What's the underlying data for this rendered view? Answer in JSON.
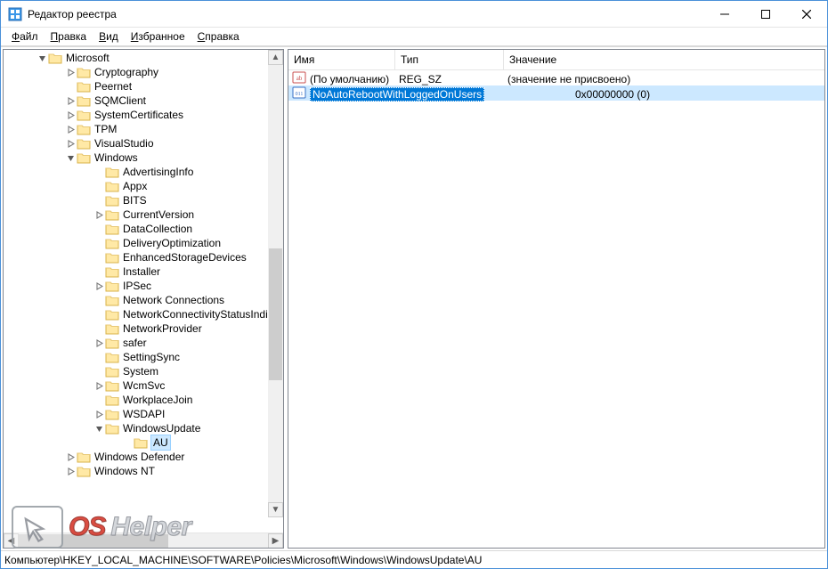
{
  "window": {
    "title": "Редактор реестра"
  },
  "menus": [
    {
      "accel": "Ф",
      "rest": "айл"
    },
    {
      "accel": "П",
      "rest": "равка"
    },
    {
      "accel": "В",
      "rest": "ид"
    },
    {
      "accel": "И",
      "rest": "збранное"
    },
    {
      "accel": "С",
      "rest": "правка"
    }
  ],
  "tree": {
    "root": {
      "name": "Microsoft",
      "children": [
        {
          "name": "Cryptography",
          "expandable": true
        },
        {
          "name": "Peernet"
        },
        {
          "name": "SQMClient",
          "expandable": true
        },
        {
          "name": "SystemCertificates",
          "expandable": true
        },
        {
          "name": "TPM",
          "expandable": true
        },
        {
          "name": "VisualStudio",
          "expandable": true
        },
        {
          "name": "Windows",
          "expanded": true,
          "children": [
            {
              "name": "AdvertisingInfo"
            },
            {
              "name": "Appx"
            },
            {
              "name": "BITS"
            },
            {
              "name": "CurrentVersion",
              "expandable": true
            },
            {
              "name": "DataCollection"
            },
            {
              "name": "DeliveryOptimization"
            },
            {
              "name": "EnhancedStorageDevices"
            },
            {
              "name": "Installer"
            },
            {
              "name": "IPSec",
              "expandable": true
            },
            {
              "name": "Network Connections"
            },
            {
              "name": "NetworkConnectivityStatusIndicator",
              "clip": "NetworkConnectivityStatusIndic"
            },
            {
              "name": "NetworkProvider"
            },
            {
              "name": "safer",
              "expandable": true
            },
            {
              "name": "SettingSync"
            },
            {
              "name": "System"
            },
            {
              "name": "WcmSvc",
              "expandable": true
            },
            {
              "name": "WorkplaceJoin"
            },
            {
              "name": "WSDAPI",
              "expandable": true
            },
            {
              "name": "WindowsUpdate",
              "expanded": true,
              "children": [
                {
                  "name": "AU",
                  "selected": true
                }
              ]
            }
          ]
        },
        {
          "name": "Windows Defender",
          "expandable": true
        },
        {
          "name": "Windows NT",
          "expandable": true
        }
      ]
    }
  },
  "list": {
    "headers": {
      "name": "Имя",
      "type": "Тип",
      "data": "Значение"
    },
    "rows": [
      {
        "icon": "string-value-icon",
        "name": "(По умолчанию)",
        "type": "REG_SZ",
        "data": "(значение не присвоено)"
      },
      {
        "icon": "dword-value-icon",
        "name": "NoAutoRebootWithLoggedOnUsers",
        "type": "",
        "data": "0x00000000 (0)",
        "selected": true,
        "rename": true
      }
    ]
  },
  "statusbar": "Компьютер\\HKEY_LOCAL_MACHINE\\SOFTWARE\\Policies\\Microsoft\\Windows\\WindowsUpdate\\AU",
  "watermark": {
    "os": "OS",
    "helper": "Helper"
  }
}
